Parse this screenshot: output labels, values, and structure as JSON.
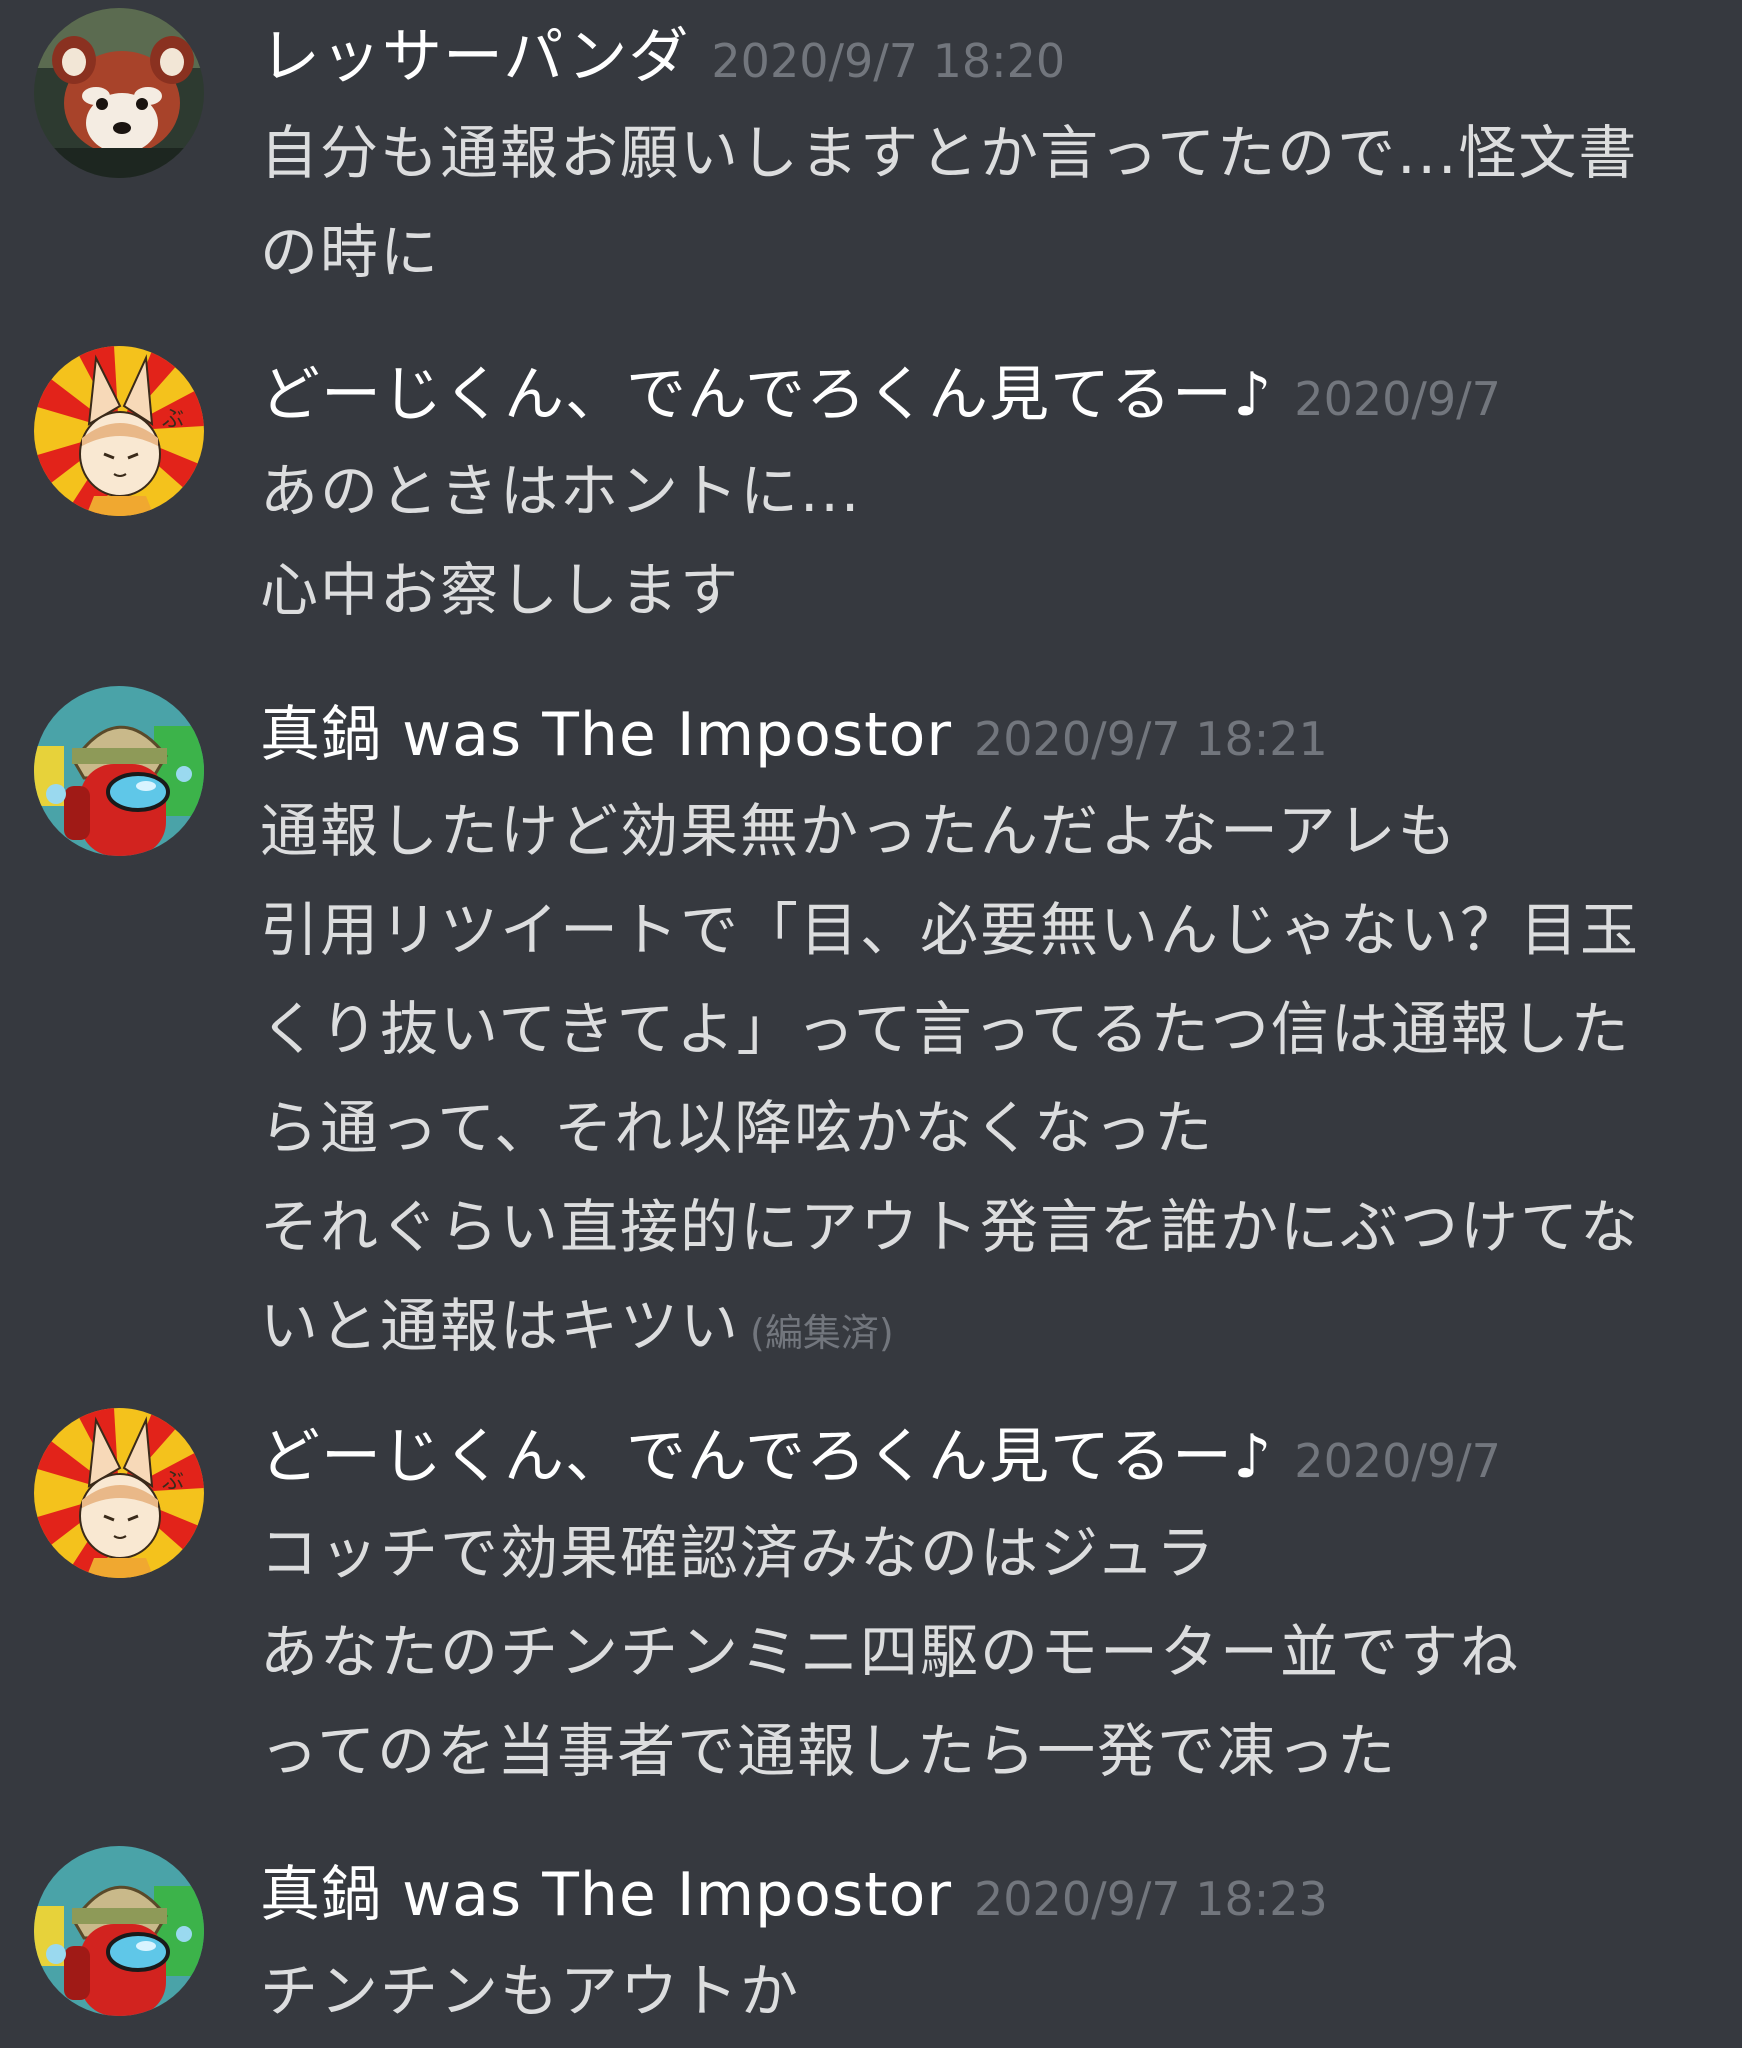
{
  "messages": [
    {
      "author": "レッサーパンダ",
      "timestamp": "2020/9/7 18:20",
      "avatar_icon": "red-panda-avatar-icon",
      "lines": [
        "自分も通報お願いしますとか言ってたので...怪文書",
        "の時に"
      ]
    },
    {
      "author": "どーじくん、でんでろくん見てるー♪",
      "timestamp": "2020/9/7",
      "avatar_icon": "fox-character-avatar-icon",
      "lines": [
        "あのときはホントに...",
        "心中お察しします"
      ]
    },
    {
      "author": "真鍋 was The Impostor",
      "timestamp": "2020/9/7 18:21",
      "avatar_icon": "red-crewmate-avatar-icon",
      "lines": [
        "通報したけど効果無かったんだよなーアレも",
        "引用リツイートで「目、必要無いんじゃない？目玉",
        "くり抜いてきてよ」って言ってるたつ信は通報した",
        "ら通って、それ以降呟かなくなった",
        "それぐらい直接的にアウト発言を誰かにぶつけてな",
        "いと通報はキツい"
      ],
      "edited_label": "(編集済)"
    },
    {
      "author": "どーじくん、でんでろくん見てるー♪",
      "timestamp": "2020/9/7",
      "avatar_icon": "fox-character-avatar-icon",
      "lines": [
        "コッチで効果確認済みなのはジュラ",
        "あなたのチンチンミニ四駆のモーター並ですね",
        "ってのを当事者で通報したら一発で凍った"
      ]
    },
    {
      "author": "真鍋 was The Impostor",
      "timestamp": "2020/9/7 18:23",
      "avatar_icon": "red-crewmate-avatar-icon",
      "lines": [
        "チンチンもアウトか"
      ]
    }
  ],
  "colors": {
    "background": "#36393f",
    "username": "#ffffff",
    "timestamp": "#72767d",
    "message_text": "#dcddde"
  }
}
